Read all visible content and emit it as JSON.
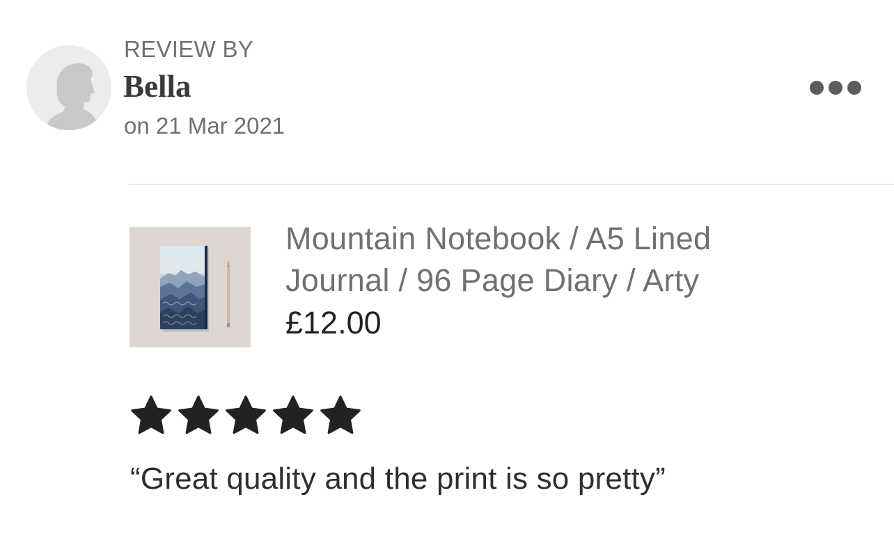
{
  "review": {
    "heading": "REVIEW BY",
    "reviewer_name": "Bella",
    "date": "on 21 Mar 2021",
    "rating": 5,
    "rating_max": 5,
    "text": "“Great quality and the print is so pretty”"
  },
  "product": {
    "title": "Mountain Notebook / A5 Lined Journal / 96 Page Diary / Arty",
    "price": "£12.00"
  },
  "icons": {
    "avatar": "person-silhouette-icon",
    "more": "more-options-icon",
    "star": "star-icon"
  },
  "colors": {
    "star": "#222222",
    "secondary_text": "#707070",
    "divider": "#e6e6e6"
  }
}
